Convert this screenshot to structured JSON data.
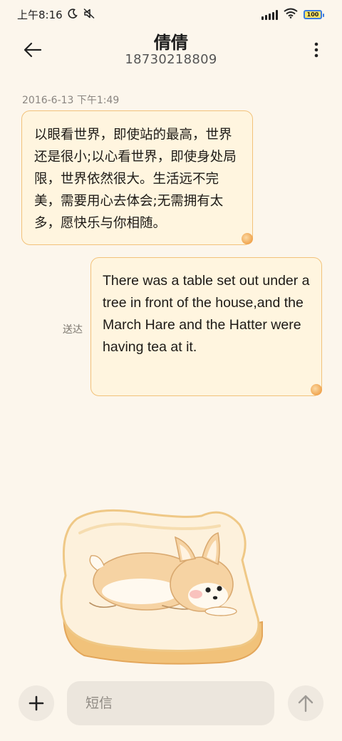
{
  "status_bar": {
    "time": "上午8:16",
    "icons": [
      "moon-icon",
      "mute-icon",
      "signal-icon",
      "wifi-icon",
      "battery-icon"
    ],
    "battery_level": "100"
  },
  "header": {
    "contact_name": "倩倩",
    "contact_number": "18730218809",
    "back_icon": "arrow-left-icon",
    "more_icon": "more-vertical-icon"
  },
  "messages": [
    {
      "timestamp": "2016-6-13 下午1:49",
      "direction": "incoming",
      "text": "以眼看世界，即使站的最高，世界还是很小;以心看世界，即使身处局限，世界依然很大。生活远不完美，需要用心去体会;无需拥有太多，愿快乐与你相随。"
    },
    {
      "direction": "outgoing",
      "status": "送达",
      "text": "There was a table set out under a tree in front of the house,and the March Hare and the Hatter were having tea at it."
    }
  ],
  "input_bar": {
    "placeholder": "短信",
    "add_icon": "plus-icon",
    "send_icon": "arrow-up-icon"
  },
  "colors": {
    "background": "#fcf6ec",
    "bubble_fill": "#fff5df",
    "bubble_border": "#f2c27a",
    "battery_accent": "#3a7be0"
  }
}
